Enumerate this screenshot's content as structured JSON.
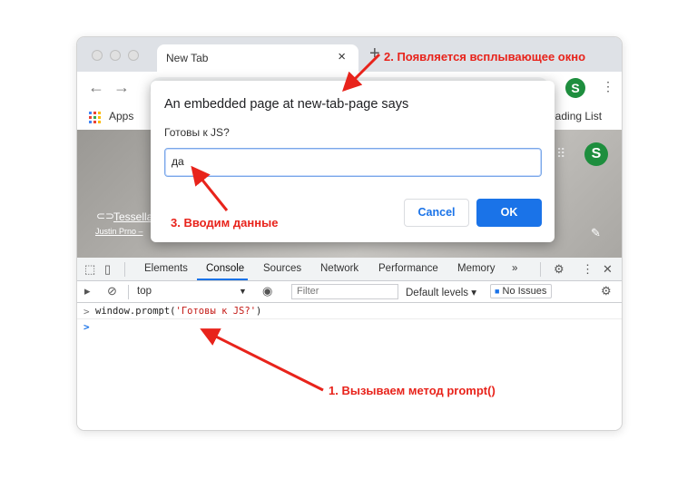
{
  "browser": {
    "tab_title": "New Tab",
    "tab_close": "×",
    "new_tab": "+",
    "nav": {
      "back": "←",
      "forward": "→"
    },
    "profile_initial": "S",
    "menu": "⋮",
    "bookmarks": {
      "apps_label": "Apps",
      "reading_list": "eading List"
    }
  },
  "page": {
    "profile_initial": "S",
    "attribution_title": "Tessella",
    "attribution_author": "Justin Prno –"
  },
  "dialog": {
    "title": "An embedded page at new-tab-page says",
    "message": "Готовы к JS?",
    "input_value": "да",
    "cancel_label": "Cancel",
    "ok_label": "OK"
  },
  "devtools": {
    "tabs": [
      "Elements",
      "Console",
      "Sources",
      "Network",
      "Performance",
      "Memory"
    ],
    "more": "»",
    "active_tab": "Console",
    "context": "top",
    "filter_placeholder": "Filter",
    "levels": "Default levels ▾",
    "issues": "No Issues",
    "console": {
      "cmd_prefix": "window.prompt(",
      "cmd_string": "'Готовы к JS?'",
      "cmd_suffix": ")",
      "prompt_symbol": ">"
    }
  },
  "annotations": {
    "step1": "1. Вызываем метод prompt()",
    "step2": "2. Появляется всплывающее окно",
    "step3": "3. Вводим данные"
  },
  "colors": {
    "accent": "#1a73e8",
    "annotation": "#e8231b",
    "profile": "#1e8e3e"
  }
}
